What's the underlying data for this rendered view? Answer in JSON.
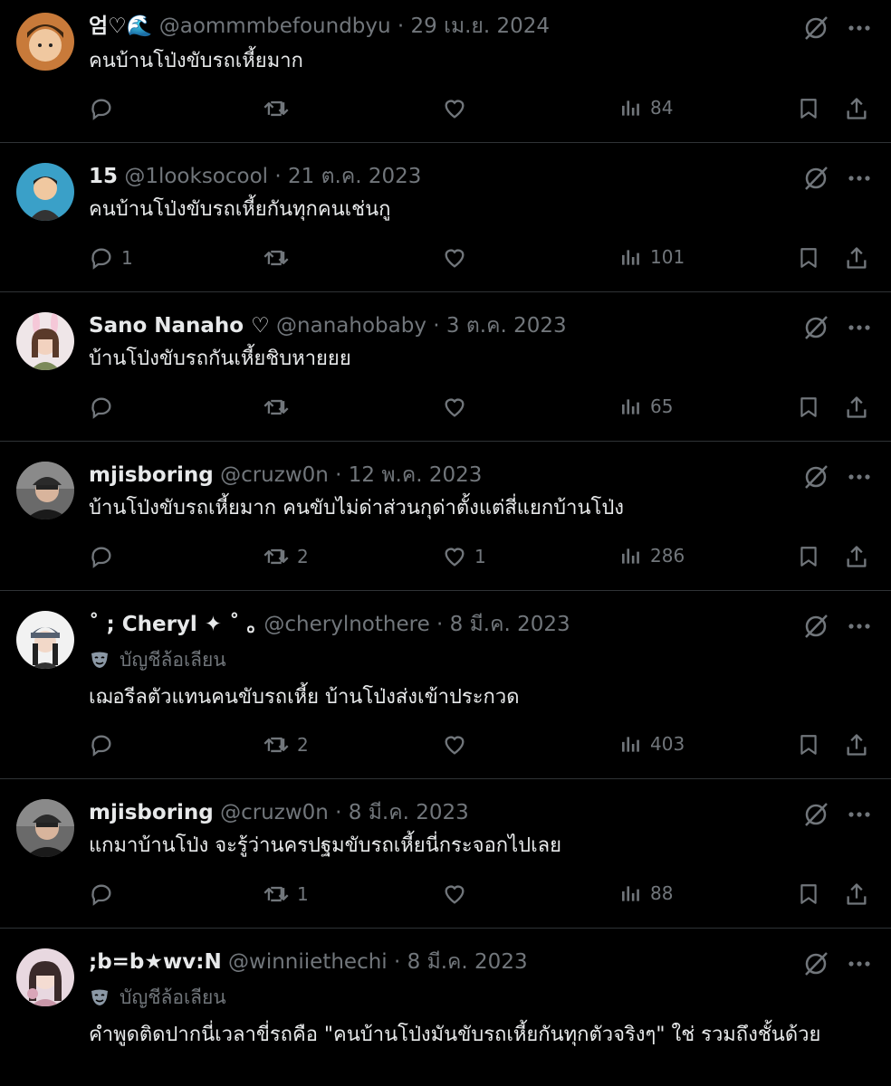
{
  "tweets": [
    {
      "name": "엄♡🌊",
      "handle": "@aommmbefoundbyu",
      "sep": "·",
      "date": "29 เม.ย. 2024",
      "text": "คนบ้านโป่งขับรถเหี้ยมาก",
      "parody": "",
      "replies": "",
      "retweets": "",
      "likes": "",
      "views": "84",
      "avatar_color": "#c87a3a"
    },
    {
      "name": "15",
      "handle": "@1looksocool",
      "sep": "·",
      "date": "21 ต.ค. 2023",
      "text": "คนบ้านโป่งขับรถเหี้ยกันทุกคนเช่นกู",
      "parody": "",
      "replies": "1",
      "retweets": "",
      "likes": "",
      "views": "101",
      "avatar_color": "#3aa0c8"
    },
    {
      "name": "Sano Nanaho ♡",
      "handle": "@nanahobaby",
      "sep": "·",
      "date": "3 ต.ค. 2023",
      "text": "บ้านโป่งขับรถกันเหี้ยชิบหายยย",
      "parody": "",
      "replies": "",
      "retweets": "",
      "likes": "",
      "views": "65",
      "avatar_color": "#d8b0c0"
    },
    {
      "name": "mjisboring",
      "handle": "@cruzw0n",
      "sep": "·",
      "date": "12 พ.ค. 2023",
      "text": "บ้านโป่งขับรถเหี้ยมาก คนขับไม่ด่าส่วนกุด่าตั้งแต่สี่แยกบ้านโป่ง",
      "parody": "",
      "replies": "",
      "retweets": "2",
      "likes": "1",
      "views": "286",
      "avatar_color": "#5a5a5a"
    },
    {
      "name": "˚ ; Cheryl ✦ ˚ ｡",
      "handle": "@cherylnothere",
      "sep": "·",
      "date": "8 มี.ค. 2023",
      "text": "เฌอรีลตัวแทนคนขับรถเหี้ย บ้านโป่งส่งเข้าประกวด",
      "parody": "บัญชีล้อเลียน",
      "replies": "",
      "retweets": "2",
      "likes": "",
      "views": "403",
      "avatar_color": "#e8e8e8"
    },
    {
      "name": "mjisboring",
      "handle": "@cruzw0n",
      "sep": "·",
      "date": "8 มี.ค. 2023",
      "text": "แกมาบ้านโป่ง จะรู้ว่านครปฐมขับรถเหี้ยนี่กระจอกไปเลย",
      "parody": "",
      "replies": "",
      "retweets": "1",
      "likes": "",
      "views": "88",
      "avatar_color": "#5a5a5a"
    },
    {
      "name": ";b=b★wv:N",
      "handle": "@winniiethechi",
      "sep": "·",
      "date": "8 มี.ค. 2023",
      "text": "คำพูดติดปากนี่เวลาขี่รถคือ \"คนบ้านโป่งมันขับรถเหี้ยกันทุกตัวจริงๆ\" ใช่ รวมถึงชั้นด้วย",
      "parody": "บัญชีล้อเลียน",
      "replies": "",
      "retweets": "",
      "likes": "",
      "views": "",
      "avatar_color": "#d9a6b8"
    }
  ]
}
